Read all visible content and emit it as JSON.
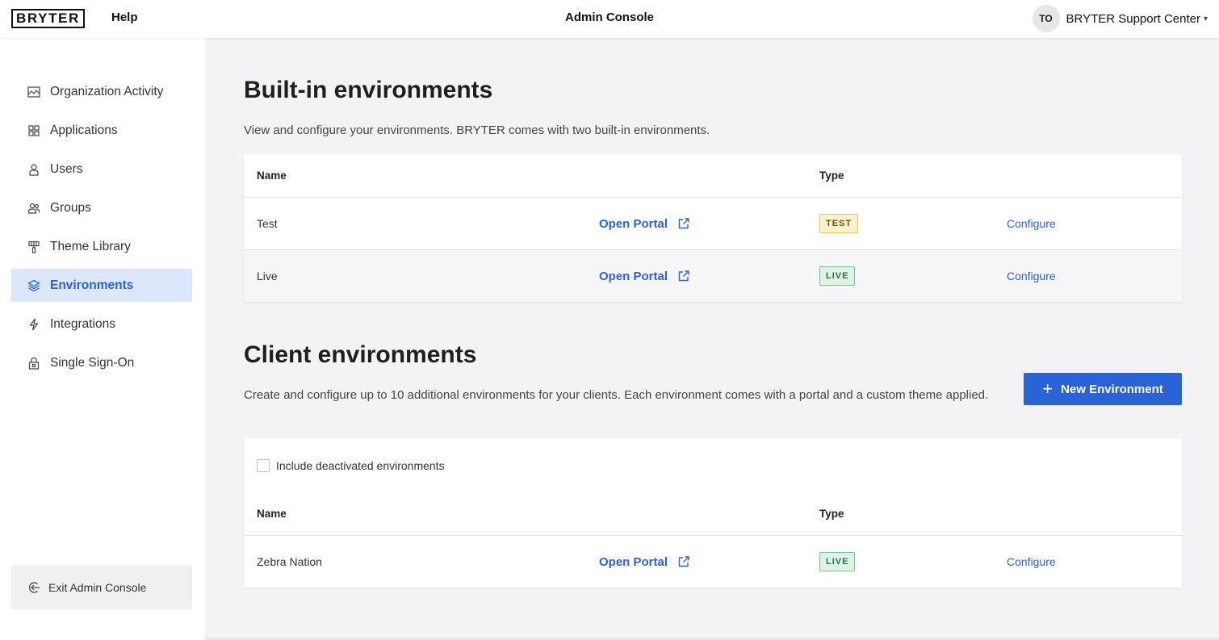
{
  "topbar": {
    "logo": "BRYTER",
    "help": "Help",
    "title": "Admin Console",
    "user_initials": "TO",
    "user_name": "BRYTER Support Center",
    "caret": "▾"
  },
  "sidebar": {
    "items": [
      {
        "label": "Organization Activity",
        "icon": "activity-icon"
      },
      {
        "label": "Applications",
        "icon": "grid-icon"
      },
      {
        "label": "Users",
        "icon": "user-icon"
      },
      {
        "label": "Groups",
        "icon": "group-icon"
      },
      {
        "label": "Theme Library",
        "icon": "paint-roller-icon"
      },
      {
        "label": "Environments",
        "icon": "layers-icon",
        "active": true
      },
      {
        "label": "Integrations",
        "icon": "lightning-icon"
      },
      {
        "label": "Single Sign-On",
        "icon": "lock-icon"
      }
    ],
    "exit_label": "Exit Admin Console"
  },
  "builtin": {
    "title": "Built-in environments",
    "description": "View and configure your environments. BRYTER comes with two built-in environments.",
    "headers": {
      "name": "Name",
      "type": "Type"
    },
    "rows": [
      {
        "name": "Test",
        "portal": "Open Portal",
        "type": "TEST",
        "configure": "Configure"
      },
      {
        "name": "Live",
        "portal": "Open Portal",
        "type": "LIVE",
        "configure": "Configure"
      }
    ]
  },
  "client": {
    "title": "Client environments",
    "description": "Create and configure up to 10 additional environments for your clients. Each environment comes with a portal and a custom theme applied.",
    "new_button": "New Environment",
    "checkbox_label": "Include deactivated environments",
    "headers": {
      "name": "Name",
      "type": "Type"
    },
    "rows": [
      {
        "name": "Zebra Nation",
        "portal": "Open Portal",
        "type": "LIVE",
        "configure": "Configure"
      }
    ]
  },
  "colors": {
    "accent": "#2a62d8",
    "active_bg": "#dde7fb",
    "test_badge": "#fcf1cc",
    "live_badge": "#ddf3e6"
  }
}
